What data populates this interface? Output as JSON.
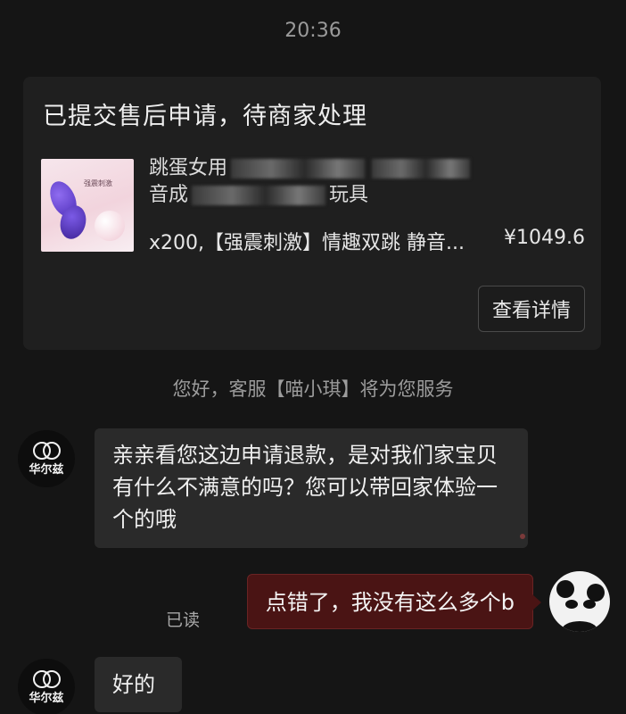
{
  "timestamp": "20:36",
  "order": {
    "status": "已提交售后申请，待商家处理",
    "title_start": "跳蛋女用",
    "title_line2_start": "音成",
    "title_end": "玩具",
    "variant": "x200,【强震刺激】情趣双跳 静音...",
    "price": "¥1049.6",
    "detail_button": "查看详情",
    "thumb_label": "强震刺激"
  },
  "system_notice": "您好，客服【喵小琪】将为您服务",
  "merchant": {
    "logo_text": "华尔兹"
  },
  "messages": [
    {
      "from": "merchant",
      "text": "亲亲看您这边申请退款，是对我们家宝贝有什么不满意的吗？您可以带回家体验一个的哦"
    },
    {
      "from": "user",
      "text": "点错了，我没有这么多个b",
      "status": "已读"
    },
    {
      "from": "merchant",
      "text": "好的"
    }
  ]
}
